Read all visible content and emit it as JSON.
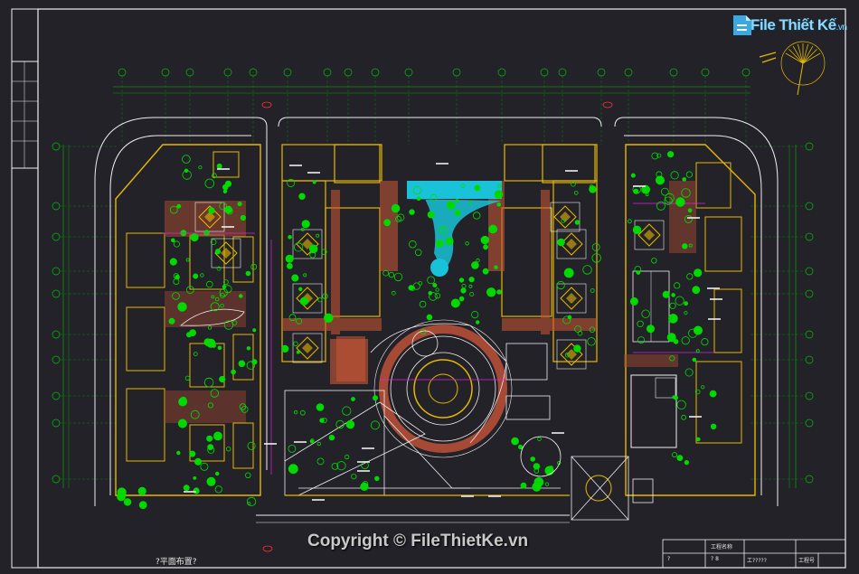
{
  "watermark": {
    "logo_text": "File Thiết Kế",
    "logo_suffix": ".vn",
    "copyright": "Copyright © FileThietKe.vn"
  },
  "drawing": {
    "caption": "?平面布置?",
    "title_block": {
      "cell_a": "工程名称",
      "cell_b": "? 8",
      "cell_c": "工?????",
      "cell_d": "?",
      "cell_e": "工程号"
    }
  },
  "colors": {
    "background": "#222228",
    "building": "#e6b800",
    "greenery": "#00e000",
    "paving": "#d4583a",
    "grid_line": "#00c000",
    "outline": "#f0f0f0",
    "water": "#19c2d8",
    "magenta": "#e020e0"
  },
  "icons": [
    "north-arrow-icon",
    "logo-icon"
  ]
}
